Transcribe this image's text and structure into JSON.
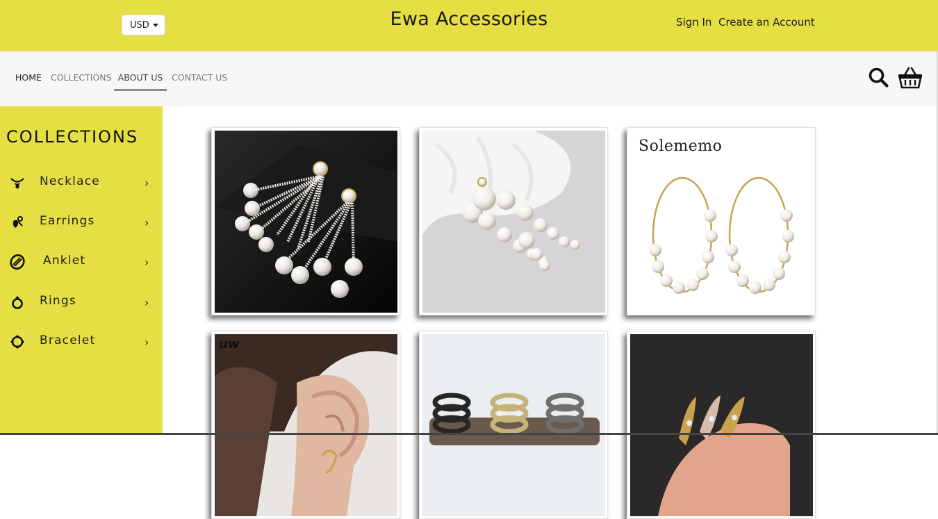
{
  "header": {
    "currency": "USD",
    "brand": "Ewa Accessories",
    "sign_in": "Sign In",
    "create_account": "Create an Account"
  },
  "nav": {
    "home": "HOME",
    "collections": "COLLECTIONS",
    "about": "ABOUT US",
    "contact": "CONTACT US",
    "active": "ABOUT US"
  },
  "sidebar": {
    "title": "COLLECTIONS",
    "items": [
      {
        "label": "Necklace",
        "icon": "necklace-icon"
      },
      {
        "label": "Earrings",
        "icon": "earrings-icon"
      },
      {
        "label": "Anklet",
        "icon": "anklet-icon"
      },
      {
        "label": "Rings",
        "icon": "ring-icon"
      },
      {
        "label": "Bracelet",
        "icon": "bracelet-icon"
      }
    ]
  },
  "products": [
    {
      "image": "pearl tassel drop earrings on black",
      "brand_mark": ""
    },
    {
      "image": "graduated pearl drop earrings on white fur",
      "brand_mark": ""
    },
    {
      "image": "gold hoop pearl earrings",
      "brand_mark": "Solememo"
    },
    {
      "image": "ear cuff on model ear",
      "brand_mark": "uw"
    },
    {
      "image": "spiral ear cuffs in black gold silver",
      "brand_mark": ""
    },
    {
      "image": "crystal ear climbers on fingertip",
      "brand_mark": ""
    }
  ],
  "colors": {
    "accent": "#e6df44",
    "nav_bg": "#f6f7f9"
  }
}
